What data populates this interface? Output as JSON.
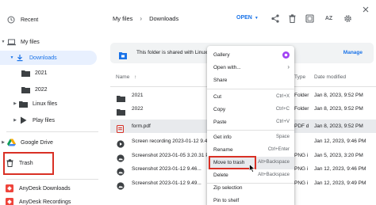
{
  "sidebar": {
    "recent": "Recent",
    "my_files": "My files",
    "downloads": "Downloads",
    "folder_2021": "2021",
    "folder_2022": "2022",
    "linux_files": "Linux files",
    "play_files": "Play files",
    "google_drive": "Google Drive",
    "trash": "Trash",
    "anydesk_downloads": "AnyDesk Downloads",
    "anydesk_recordings": "AnyDesk Recordings"
  },
  "header": {
    "breadcrumb_root": "My files",
    "breadcrumb_current": "Downloads",
    "open_label": "OPEN",
    "sort_label": "AZ"
  },
  "banner": {
    "text": "This folder is shared with Linux",
    "action": "Manage"
  },
  "list": {
    "col_name": "Name",
    "col_type": "Type",
    "col_date": "Date modified",
    "rows": [
      {
        "name": "2021",
        "type": "Folder",
        "date": "Jan 8, 2023, 9:52 PM",
        "kind": "folder"
      },
      {
        "name": "2022",
        "type": "Folder",
        "date": "Jan 8, 2023, 9:52 PM",
        "kind": "folder"
      },
      {
        "name": "form.pdf",
        "type": "PDF d",
        "date": "Jan 8, 2023, 9:52 PM",
        "kind": "pdf"
      },
      {
        "name": "Screen recording 2023-01-12 9.46.02 PM",
        "type": "",
        "date": "Jan 12, 2023, 9:46 PM",
        "kind": "video"
      },
      {
        "name": "Screenshot 2023-01-05 3.20.31 PM",
        "type": "PNG i",
        "date": "Jan 5, 2023, 3:20 PM",
        "kind": "image"
      },
      {
        "name": "Screenshot 2023-01-12 9.46...",
        "type": "PNG i",
        "date": "Jan 12, 2023, 9:46 PM",
        "kind": "image"
      },
      {
        "name": "Screenshot 2023-01-12 9.49...",
        "type": "PNG i",
        "date": "Jan 12, 2023, 9:49 PM",
        "kind": "image"
      }
    ]
  },
  "menu": {
    "gallery": "Gallery",
    "open_with": "Open with...",
    "share": "Share",
    "cut": "Cut",
    "cut_sc": "Ctrl+X",
    "copy": "Copy",
    "copy_sc": "Ctrl+C",
    "paste": "Paste",
    "paste_sc": "Ctrl+V",
    "get_info": "Get info",
    "get_info_sc": "Space",
    "rename": "Rename",
    "rename_sc": "Ctrl+Enter",
    "move_to_trash": "Move to trash",
    "move_to_trash_sc": "Alt+Backspace",
    "delete": "Delete",
    "delete_sc": "Alt+Backspace",
    "zip": "Zip selection",
    "pin": "Pin to shelf"
  },
  "colors": {
    "accent": "#1a73e8",
    "highlight_red": "#d93025",
    "selected_bg": "#e8f0fe"
  }
}
